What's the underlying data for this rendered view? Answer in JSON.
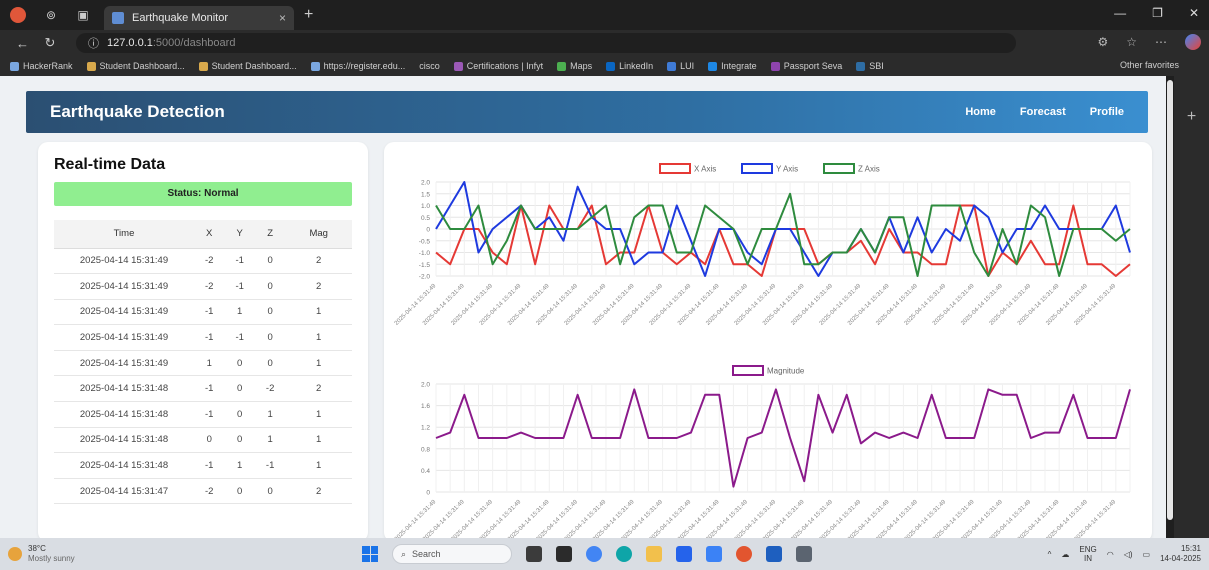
{
  "browser": {
    "tab_title": "Earthquake Monitor",
    "tab_close": "×",
    "new_tab": "+",
    "url_host": "127.0.0.1",
    "url_path": ":5000/dashboard",
    "bookmarks": [
      "HackerRank",
      "Student Dashboard...",
      "Student Dashboard...",
      "https://register.edu...",
      "cisco",
      "Certifications | Infyt",
      "Maps",
      "LinkedIn",
      "LUI",
      "Integrate",
      "Passport Seva",
      "SBI"
    ],
    "other_bookmarks": "Other favorites"
  },
  "header": {
    "brand": "Earthquake Detection",
    "nav": [
      "Home",
      "Forecast",
      "Profile"
    ]
  },
  "left": {
    "title": "Real-time Data",
    "status": "Status: Normal",
    "columns": [
      "Time",
      "X",
      "Y",
      "Z",
      "Mag"
    ],
    "rows": [
      [
        "2025-04-14 15:31:49",
        "-2",
        "-1",
        "0",
        "2"
      ],
      [
        "2025-04-14 15:31:49",
        "-2",
        "-1",
        "0",
        "2"
      ],
      [
        "2025-04-14 15:31:49",
        "-1",
        "1",
        "0",
        "1"
      ],
      [
        "2025-04-14 15:31:49",
        "-1",
        "-1",
        "0",
        "1"
      ],
      [
        "2025-04-14 15:31:49",
        "1",
        "0",
        "0",
        "1"
      ],
      [
        "2025-04-14 15:31:48",
        "-1",
        "0",
        "-2",
        "2"
      ],
      [
        "2025-04-14 15:31:48",
        "-1",
        "0",
        "1",
        "1"
      ],
      [
        "2025-04-14 15:31:48",
        "0",
        "0",
        "1",
        "1"
      ],
      [
        "2025-04-14 15:31:48",
        "-1",
        "1",
        "-1",
        "1"
      ],
      [
        "2025-04-14 15:31:47",
        "-2",
        "0",
        "0",
        "2"
      ]
    ]
  },
  "chart_data": [
    {
      "type": "line",
      "legend_position": "top",
      "ylim": [
        -2.0,
        2.0
      ],
      "yticks": [
        "2.0",
        "1.5",
        "1.0",
        "0.5",
        "0",
        "-0.5",
        "-1.0",
        "-1.5",
        "-2.0"
      ],
      "x_count": 50,
      "x_label_sample": "2025-04-14 15:31:49",
      "grid": true,
      "series": [
        {
          "name": "X Axis",
          "color": "#e53935",
          "values": [
            -1,
            -1.5,
            0,
            0,
            -1,
            -1.5,
            1,
            -1.5,
            1,
            0,
            0,
            1,
            -1.5,
            -1,
            -1,
            1,
            -1,
            -1.5,
            -1,
            -1.5,
            0,
            -1.5,
            -1.5,
            -2,
            0,
            0,
            0,
            -1.5,
            -1,
            -1,
            -0.5,
            -1.5,
            0,
            -1,
            -1,
            -1.5,
            -1.5,
            1,
            1,
            -2,
            -1,
            -1.5,
            -0.5,
            -1.5,
            -1.5,
            1,
            -1.5,
            -1.5,
            -2,
            -1.5
          ]
        },
        {
          "name": "Y Axis",
          "color": "#1e3adf",
          "values": [
            0,
            1,
            2,
            -1,
            0,
            0.5,
            1,
            0,
            0.5,
            -0.5,
            1.8,
            0.5,
            0,
            0,
            -1.5,
            -1,
            -1,
            1,
            -0.5,
            -2,
            0,
            0,
            -1,
            -1.5,
            0,
            0,
            -1,
            -2,
            -1,
            -1,
            0,
            -1,
            0.5,
            -1,
            0.5,
            -1,
            0,
            -0.5,
            1,
            0.5,
            -1,
            0,
            0,
            1,
            0,
            0,
            0,
            0,
            1,
            -1
          ]
        },
        {
          "name": "Z Axis",
          "color": "#2e8b3e",
          "values": [
            1,
            0,
            0,
            1,
            -1.5,
            -0.5,
            1,
            0,
            0,
            0,
            0,
            0.5,
            1,
            -1.5,
            0.5,
            1,
            1,
            -1,
            -1,
            1,
            0.5,
            0,
            -1.5,
            0,
            0,
            1.5,
            -1.5,
            -1.5,
            -1,
            -1,
            0,
            -1,
            0.5,
            0.5,
            -2,
            1,
            1,
            1,
            -1,
            -2,
            0,
            -1.5,
            1,
            0.5,
            -2,
            0,
            0,
            0,
            -0.5,
            0
          ]
        }
      ]
    },
    {
      "type": "line",
      "legend_position": "top",
      "ylim": [
        0,
        2.0
      ],
      "yticks": [
        "2.0",
        "1.6",
        "1.2",
        "0.8",
        "0.4",
        "0"
      ],
      "x_count": 50,
      "grid": true,
      "series": [
        {
          "name": "Magnitude",
          "color": "#8b1a8b",
          "values": [
            1.0,
            1.1,
            1.8,
            1.0,
            1.0,
            1.0,
            1.1,
            1.0,
            1.0,
            1.0,
            1.8,
            1.0,
            1.0,
            1.0,
            1.9,
            1.0,
            1.0,
            1.0,
            1.1,
            1.8,
            1.8,
            0.1,
            1.0,
            1.1,
            1.9,
            1.0,
            0.2,
            1.8,
            1.1,
            1.8,
            0.9,
            1.1,
            1.0,
            1.1,
            1.0,
            1.8,
            1.0,
            1.0,
            1.0,
            1.9,
            1.8,
            1.8,
            1.0,
            1.1,
            1.1,
            1.8,
            1.0,
            1.0,
            1.0,
            1.9
          ]
        }
      ]
    }
  ],
  "taskbar": {
    "weather_temp": "38°C",
    "weather_desc": "Mostly sunny",
    "search": "Search",
    "lang": "ENG",
    "lang_sub": "IN",
    "time": "15:31",
    "date": "14-04-2025"
  }
}
